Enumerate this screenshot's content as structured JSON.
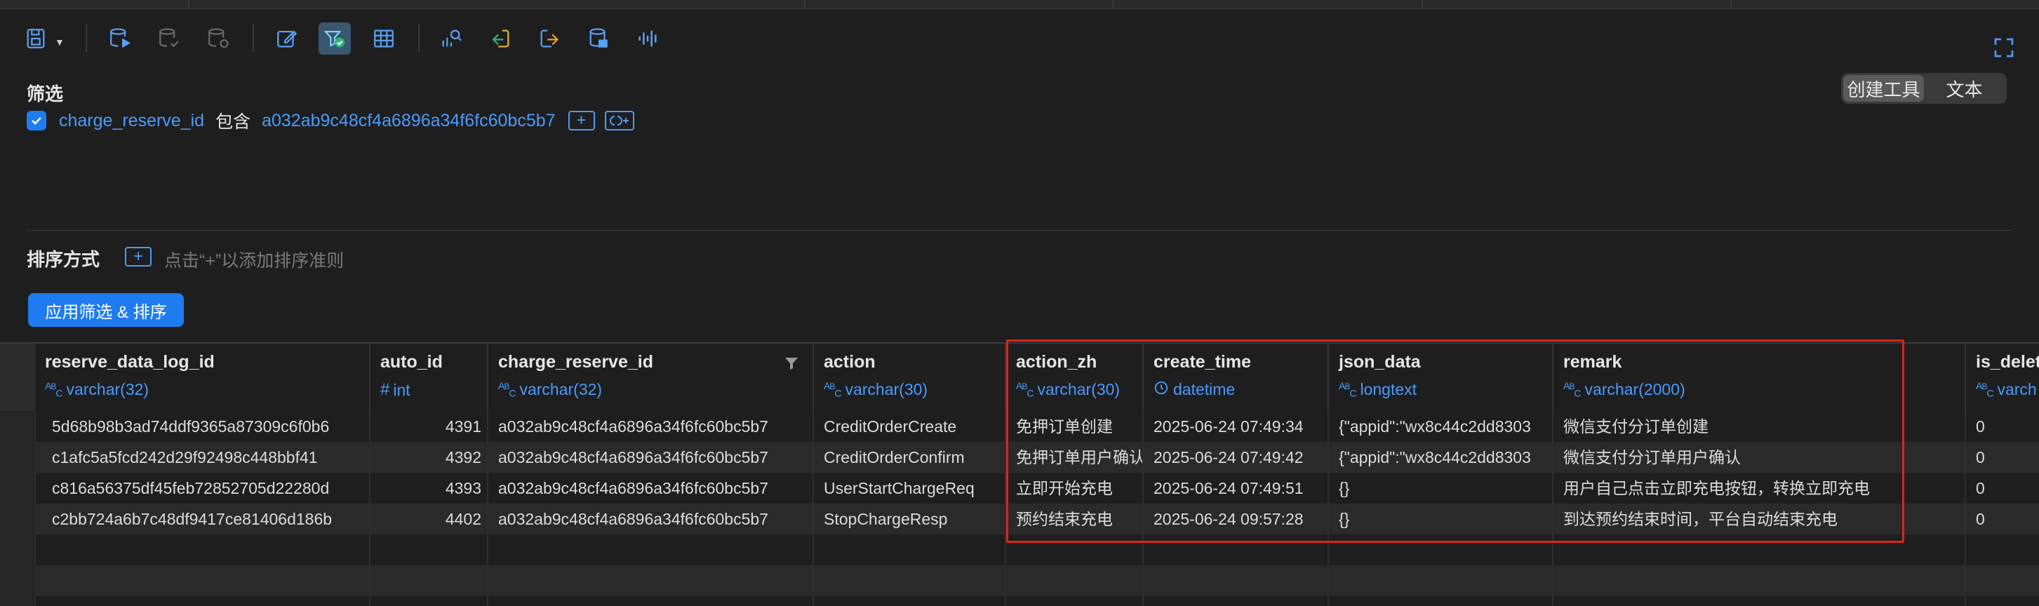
{
  "toolbar": {
    "icons": [
      "save-icon",
      "run-database-icon",
      "database-check-icon",
      "database-refresh-icon",
      "edit-icon",
      "filter-icon",
      "grid-icon",
      "chart-search-icon",
      "import-icon",
      "export-icon",
      "database-stats-icon",
      "waveform-icon",
      "fullscreen-icon"
    ],
    "accent": "#1f7cf0"
  },
  "filter": {
    "title": "筛选",
    "field": "charge_reserve_id",
    "operator": "包含",
    "value": "a032ab9c48cf4a6896a34f6fc60bc5b7",
    "plus": "+",
    "mode_tabs": [
      "创建工具",
      "文本"
    ],
    "active_tab": "创建工具"
  },
  "sort": {
    "title": "排序方式",
    "plus": "+",
    "hint": "点击“+”以添加排序准则"
  },
  "apply_button": "应用筛选 & 排序",
  "columns": [
    {
      "name": "reserve_data_log_id",
      "type": "varchar(32)",
      "type_icon": "ABC"
    },
    {
      "name": "auto_id",
      "type": "int",
      "type_icon": "#"
    },
    {
      "name": "charge_reserve_id",
      "type": "varchar(32)",
      "type_icon": "ABC"
    },
    {
      "name": "action",
      "type": "varchar(30)",
      "type_icon": "ABC"
    },
    {
      "name": "action_zh",
      "type": "varchar(30)",
      "type_icon": "ABC"
    },
    {
      "name": "create_time",
      "type": "datetime",
      "type_icon": "clock"
    },
    {
      "name": "json_data",
      "type": "longtext",
      "type_icon": "ABC"
    },
    {
      "name": "remark",
      "type": "varchar(2000)",
      "type_icon": "ABC"
    },
    {
      "name": "is_delet",
      "type": "varch",
      "type_icon": "ABC"
    }
  ],
  "rows": [
    [
      "5d68b98b3ad74ddf9365a87309c6f0b6",
      "4391",
      "a032ab9c48cf4a6896a34f6fc60bc5b7",
      "CreditOrderCreate",
      "免押订单创建",
      "2025-06-24 07:49:34",
      "{\"appid\":\"wx8c44c2dd8303",
      "微信支付分订单创建",
      "0"
    ],
    [
      "c1afc5a5fcd242d29f92498c448bbf41",
      "4392",
      "a032ab9c48cf4a6896a34f6fc60bc5b7",
      "CreditOrderConfirm",
      "免押订单用户确认",
      "2025-06-24 07:49:42",
      "{\"appid\":\"wx8c44c2dd8303",
      "微信支付分订单用户确认",
      "0"
    ],
    [
      "c816a56375df45feb72852705d22280d",
      "4393",
      "a032ab9c48cf4a6896a34f6fc60bc5b7",
      "UserStartChargeReq",
      "立即开始充电",
      "2025-06-24 07:49:51",
      "{}",
      "用户自己点击立即充电按钮，转换立即充电",
      "0"
    ],
    [
      "c2bb724a6b7c48df9417ce81406d186b",
      "4402",
      "a032ab9c48cf4a6896a34f6fc60bc5b7",
      "StopChargeResp",
      "预约结束充电",
      "2025-06-24 09:57:28",
      "{}",
      "到达预约结束时间，平台自动结束充电",
      "0"
    ]
  ]
}
